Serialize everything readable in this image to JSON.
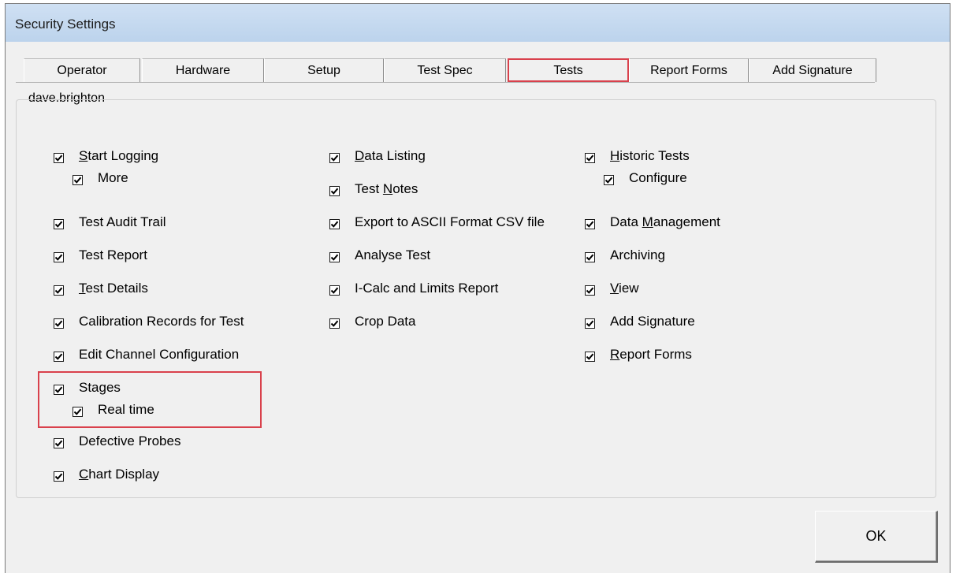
{
  "window": {
    "title": "Security Settings"
  },
  "tabs": [
    {
      "label": "Operator",
      "selected": false
    },
    {
      "label": "Hardware",
      "selected": false
    },
    {
      "label": "Setup",
      "selected": false
    },
    {
      "label": "Test Spec",
      "selected": false
    },
    {
      "label": "Tests",
      "selected": true
    },
    {
      "label": "Report Forms",
      "selected": false,
      "accel": "R"
    },
    {
      "label": "Add Signature",
      "selected": false
    }
  ],
  "user": "dave.brighton",
  "columns": [
    [
      {
        "label": "Start Logging",
        "checked": true,
        "accel_index": 0
      },
      {
        "label": "More",
        "checked": true,
        "indent": true
      },
      {
        "label": "Test Audit Trail",
        "checked": true
      },
      {
        "label": "Test Report",
        "checked": true
      },
      {
        "label": "Test Details",
        "checked": true,
        "accel_index": 0
      },
      {
        "label": "Calibration Records for Test",
        "checked": true
      },
      {
        "label": "Edit Channel Configuration",
        "checked": true
      },
      {
        "label": "Stages",
        "checked": true
      },
      {
        "label": "Real time",
        "checked": true,
        "indent": true
      },
      {
        "label": "Defective Probes",
        "checked": true
      },
      {
        "label": "Chart Display",
        "checked": true,
        "accel_index": 0
      }
    ],
    [
      {
        "label": "Data Listing",
        "checked": true,
        "accel_index": 0
      },
      {
        "label": "Test Notes",
        "checked": true,
        "accel_index": 5
      },
      {
        "label": "Export to ASCII Format CSV file",
        "checked": true
      },
      {
        "label": "Analyse Test",
        "checked": true
      },
      {
        "label": "I-Calc and Limits Report",
        "checked": true
      },
      {
        "label": "Crop Data",
        "checked": true
      }
    ],
    [
      {
        "label": "Historic Tests",
        "checked": true,
        "accel_index": 0
      },
      {
        "label": "Configure",
        "checked": true,
        "indent": true
      },
      {
        "label": "Data Management",
        "checked": true,
        "accel_index": 5
      },
      {
        "label": "Archiving",
        "checked": true
      },
      {
        "label": "View",
        "checked": true,
        "accel_index": 0
      },
      {
        "label": "Add Signature",
        "checked": true
      },
      {
        "label": "Report Forms",
        "checked": true,
        "accel_index": 0
      }
    ]
  ],
  "ok_button": {
    "label": "OK",
    "accel_index": 0
  },
  "colors": {
    "highlight": "#d9414c",
    "titlebar": "#c8dbf0",
    "face": "#f0f0f0"
  }
}
